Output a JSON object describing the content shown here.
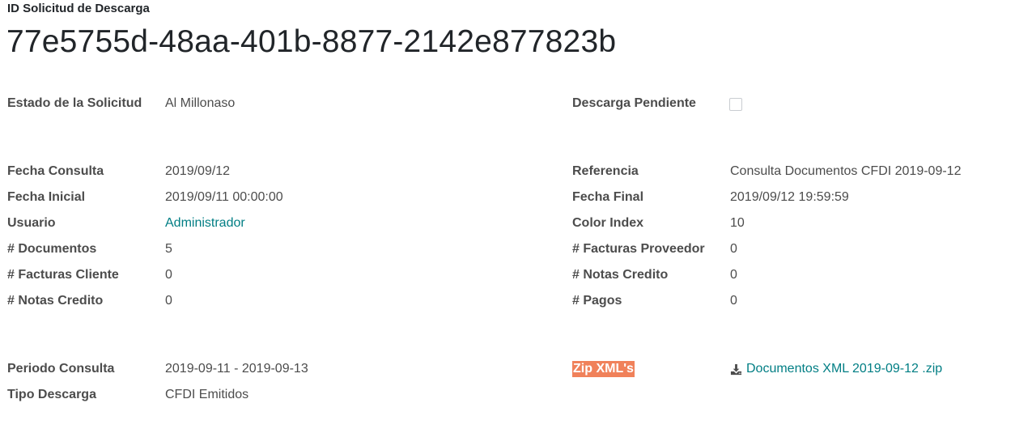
{
  "header": {
    "id_label": "ID Solicitud de Descarga",
    "id_value": "77e5755d-48aa-401b-8877-2142e877823b"
  },
  "fields": {
    "estado_label": "Estado de la Solicitud",
    "estado_value": "Al Millonaso",
    "descarga_pendiente_label": "Descarga Pendiente",
    "descarga_pendiente_checked": false,
    "fecha_consulta_label": "Fecha Consulta",
    "fecha_consulta_value": "2019/09/12",
    "referencia_label": "Referencia",
    "referencia_value": "Consulta Documentos CFDI 2019-09-12",
    "fecha_inicial_label": "Fecha Inicial",
    "fecha_inicial_value": "2019/09/11 00:00:00",
    "fecha_final_label": "Fecha Final",
    "fecha_final_value": "2019/09/12 19:59:59",
    "usuario_label": "Usuario",
    "usuario_value": "Administrador",
    "color_index_label": "Color Index",
    "color_index_value": "10",
    "documentos_label": "# Documentos",
    "documentos_value": "5",
    "facturas_proveedor_label": "# Facturas Proveedor",
    "facturas_proveedor_value": "0",
    "facturas_cliente_label": "# Facturas Cliente",
    "facturas_cliente_value": "0",
    "notas_credito_r_label": "# Notas Credito",
    "notas_credito_r_value": "0",
    "notas_credito_l_label": "# Notas Credito",
    "notas_credito_l_value": "0",
    "pagos_label": "# Pagos",
    "pagos_value": "0",
    "periodo_label": "Periodo Consulta",
    "periodo_value": "2019-09-11 - 2019-09-13",
    "zip_label": "Zip XML's",
    "zip_file": "Documentos XML 2019-09-12 .zip",
    "tipo_descarga_label": "Tipo Descarga",
    "tipo_descarga_value": "CFDI Emitidos"
  },
  "icons": {
    "download": "download-icon"
  },
  "colors": {
    "link": "#017e84",
    "zip_label_bg": "#f0815a",
    "label_text": "#4c4c4c"
  }
}
